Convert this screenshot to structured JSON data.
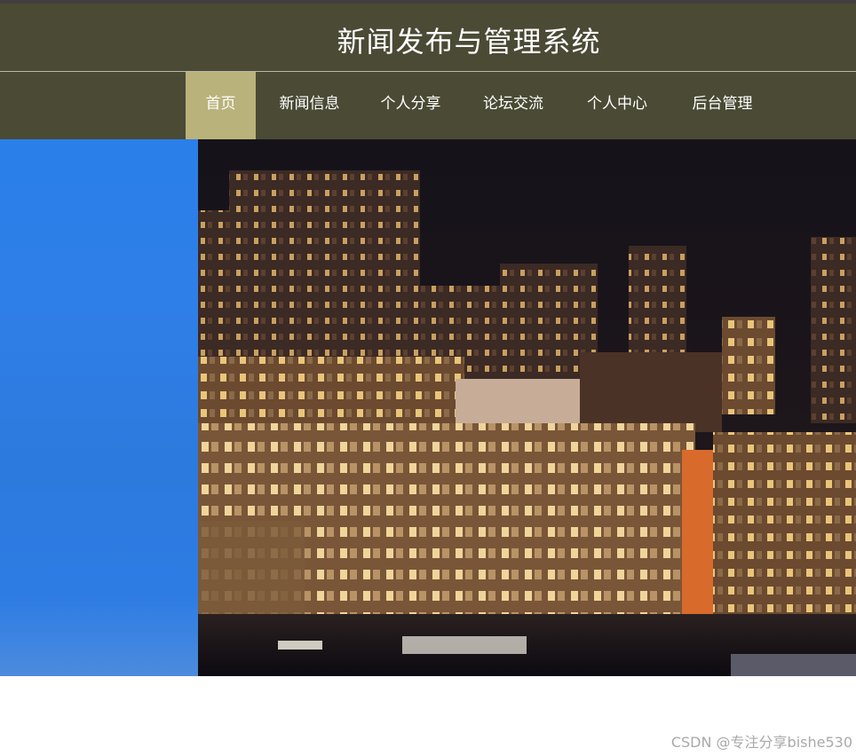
{
  "header": {
    "site_title": "新闻发布与管理系统"
  },
  "nav": {
    "items": [
      {
        "label": "首页",
        "active": true
      },
      {
        "label": "新闻信息",
        "active": false
      },
      {
        "label": "个人分享",
        "active": false
      },
      {
        "label": "论坛交流",
        "active": false
      },
      {
        "label": "个人中心",
        "active": false
      },
      {
        "label": "后台管理",
        "active": false
      }
    ]
  },
  "hero": {
    "image_subject": "city-night-skyline-photo"
  },
  "watermark": {
    "text": "CSDN @专注分享bishe530"
  },
  "colors": {
    "header_bg": "#4a4a35",
    "nav_active_bg": "#b9b27a",
    "hero_left_blue": "#2a7fe9"
  }
}
